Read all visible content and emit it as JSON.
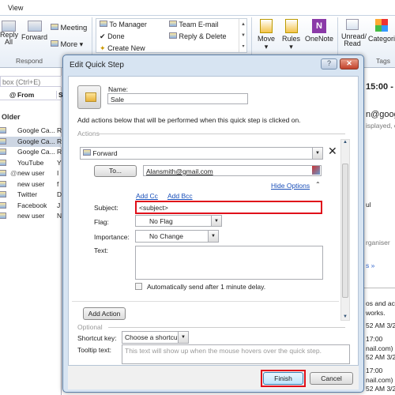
{
  "ribbon": {
    "tab": "View",
    "respond": {
      "reply_all": "Reply All",
      "forward": "Forward",
      "meeting": "Meeting",
      "more": "More",
      "group": "Respond"
    },
    "quick_steps": [
      "To Manager",
      "Done",
      "Create New",
      "Team E-mail",
      "Reply & Delete"
    ],
    "move": {
      "move": "Move",
      "rules": "Rules",
      "onenote": "OneNote"
    },
    "tags": {
      "unread": "Unread/ Read",
      "categorize": "Categori",
      "group": "Tags"
    }
  },
  "mail_list": {
    "search_placeholder": "box (Ctrl+E)",
    "col_from": "From",
    "col_subject": "S",
    "group": "Older",
    "items": [
      {
        "from": "Google Ca...",
        "subject": "R"
      },
      {
        "from": "Google Ca...",
        "subject": "R"
      },
      {
        "from": "Google Ca...",
        "subject": "R"
      },
      {
        "from": "YouTube",
        "subject": "Y"
      },
      {
        "from": "new user",
        "subject": "I"
      },
      {
        "from": "new user",
        "subject": "f"
      },
      {
        "from": "Twitter",
        "subject": "D"
      },
      {
        "from": "Facebook",
        "subject": "J"
      },
      {
        "from": "new user",
        "subject": "N"
      }
    ]
  },
  "reading_pane": [
    "15:00 -",
    "n@goog",
    "isplayed, c",
    "ul",
    "rganiser",
    "s »",
    "os and act",
    "works.",
    "52 AM 3/2",
    "17:00",
    "nail.com)",
    "52 AM 3/2",
    "17:00",
    "nail.com)",
    "52 AM 3/2"
  ],
  "dialog": {
    "title": "Edit Quick Step",
    "name_label": "Name:",
    "name_value": "Sale",
    "instructions": "Add actions below that will be performed when this quick step is clicked on.",
    "actions_label": "Actions",
    "action": "Forward",
    "to_button": "To...",
    "to_value": "Alansmith@gmail.com",
    "hide_options": "Hide Options",
    "add_cc": "Add Cc",
    "add_bcc": "Add Bcc",
    "subject_label": "Subject:",
    "subject_value": "<subject>",
    "flag_label": "Flag:",
    "flag_value": "No Flag",
    "importance_label": "Importance:",
    "importance_value": "No Change",
    "text_label": "Text:",
    "auto_send": "Automatically send after 1 minute delay.",
    "add_action": "Add Action",
    "optional_label": "Optional",
    "shortcut_label": "Shortcut key:",
    "shortcut_value": "Choose a shortcut",
    "tooltip_label": "Tooltip text:",
    "tooltip_placeholder": "This text will show up when the mouse hovers over the quick step.",
    "finish": "Finish",
    "cancel": "Cancel",
    "highlight_color": "#e0101a"
  }
}
